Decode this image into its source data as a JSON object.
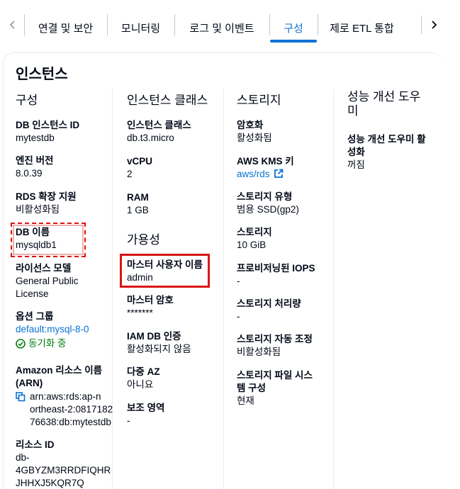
{
  "tabs": [
    {
      "label": "연결 및 보안"
    },
    {
      "label": "모니터링"
    },
    {
      "label": "로그 및 이벤트"
    },
    {
      "label": "구성"
    },
    {
      "label": "제로 ETL 통합"
    }
  ],
  "active_tab": "구성",
  "panel_title": "인스턴스",
  "columns": {
    "config": {
      "heading": "구성",
      "db_instance_id": {
        "label": "DB 인스턴스 ID",
        "value": "mytestdb"
      },
      "engine_version": {
        "label": "엔진 버전",
        "value": "8.0.39"
      },
      "rds_extended_support": {
        "label": "RDS 확장 지원",
        "value": "비활성화됨"
      },
      "db_name": {
        "label": "DB 이름",
        "value": "mysqldb1"
      },
      "license_model": {
        "label": "라이선스 모델",
        "value_line1": "General Public",
        "value_line2": "License"
      },
      "option_group": {
        "label": "옵션 그룹",
        "value": "default:mysql-8-0",
        "status": "동기화 중"
      },
      "arn": {
        "label_line1": "Amazon 리소스 이름",
        "label_line2": "(ARN)",
        "value_line1": "arn:aws:rds:ap-n",
        "value_line2": "ortheast-2:0817182",
        "value_line3": "76638:db:mytestdb"
      },
      "resource_id": {
        "label": "리소스 ID",
        "value_line1": "db-",
        "value_line2": "4GBYZM3RRDFIQHR",
        "value_line3": "JHHXJ5KQR7Q"
      }
    },
    "instance_class": {
      "heading": "인스턴스 클래스",
      "class": {
        "label": "인스턴스 클래스",
        "value": "db.t3.micro"
      },
      "vcpu": {
        "label": "vCPU",
        "value": "2"
      },
      "ram": {
        "label": "RAM",
        "value": "1 GB"
      },
      "availability_heading": "가용성",
      "master_username": {
        "label": "마스터 사용자 이름",
        "value": "admin"
      },
      "master_password": {
        "label": "마스터 암호",
        "value": "*******"
      },
      "iam_auth": {
        "label": "IAM DB 인증",
        "value": "활성화되지 않음"
      },
      "multi_az": {
        "label": "다중 AZ",
        "value": "아니요"
      },
      "secondary_zone": {
        "label": "보조 영역",
        "value": "-"
      }
    },
    "storage": {
      "heading": "스토리지",
      "encryption": {
        "label": "암호화",
        "value": "활성화됨"
      },
      "kms_key": {
        "label": "AWS KMS 키",
        "value": "aws/rds"
      },
      "storage_type": {
        "label": "스토리지 유형",
        "value": "범용 SSD(gp2)"
      },
      "storage": {
        "label": "스토리지",
        "value": "10 GiB"
      },
      "iops": {
        "label": "프로비저닝된 IOPS",
        "value": "-"
      },
      "throughput": {
        "label": "스토리지 처리량",
        "value": "-"
      },
      "autoscaling": {
        "label": "스토리지 자동 조정",
        "value": "비활성화됨"
      },
      "filesystem": {
        "label_line1": "스토리지 파일 시스",
        "label_line2": "템 구성",
        "value": "현재"
      }
    },
    "performance": {
      "heading_line1": "성능 개선 도우",
      "heading_line2": "미",
      "pi": {
        "label_line1": "성능 개선 도우미 활",
        "label_line2": "성화",
        "value": "꺼짐"
      }
    }
  },
  "colors": {
    "accent": "#0972d3",
    "success": "#037f0c",
    "highlight": "#d91515",
    "divider": "#e9ebed"
  }
}
